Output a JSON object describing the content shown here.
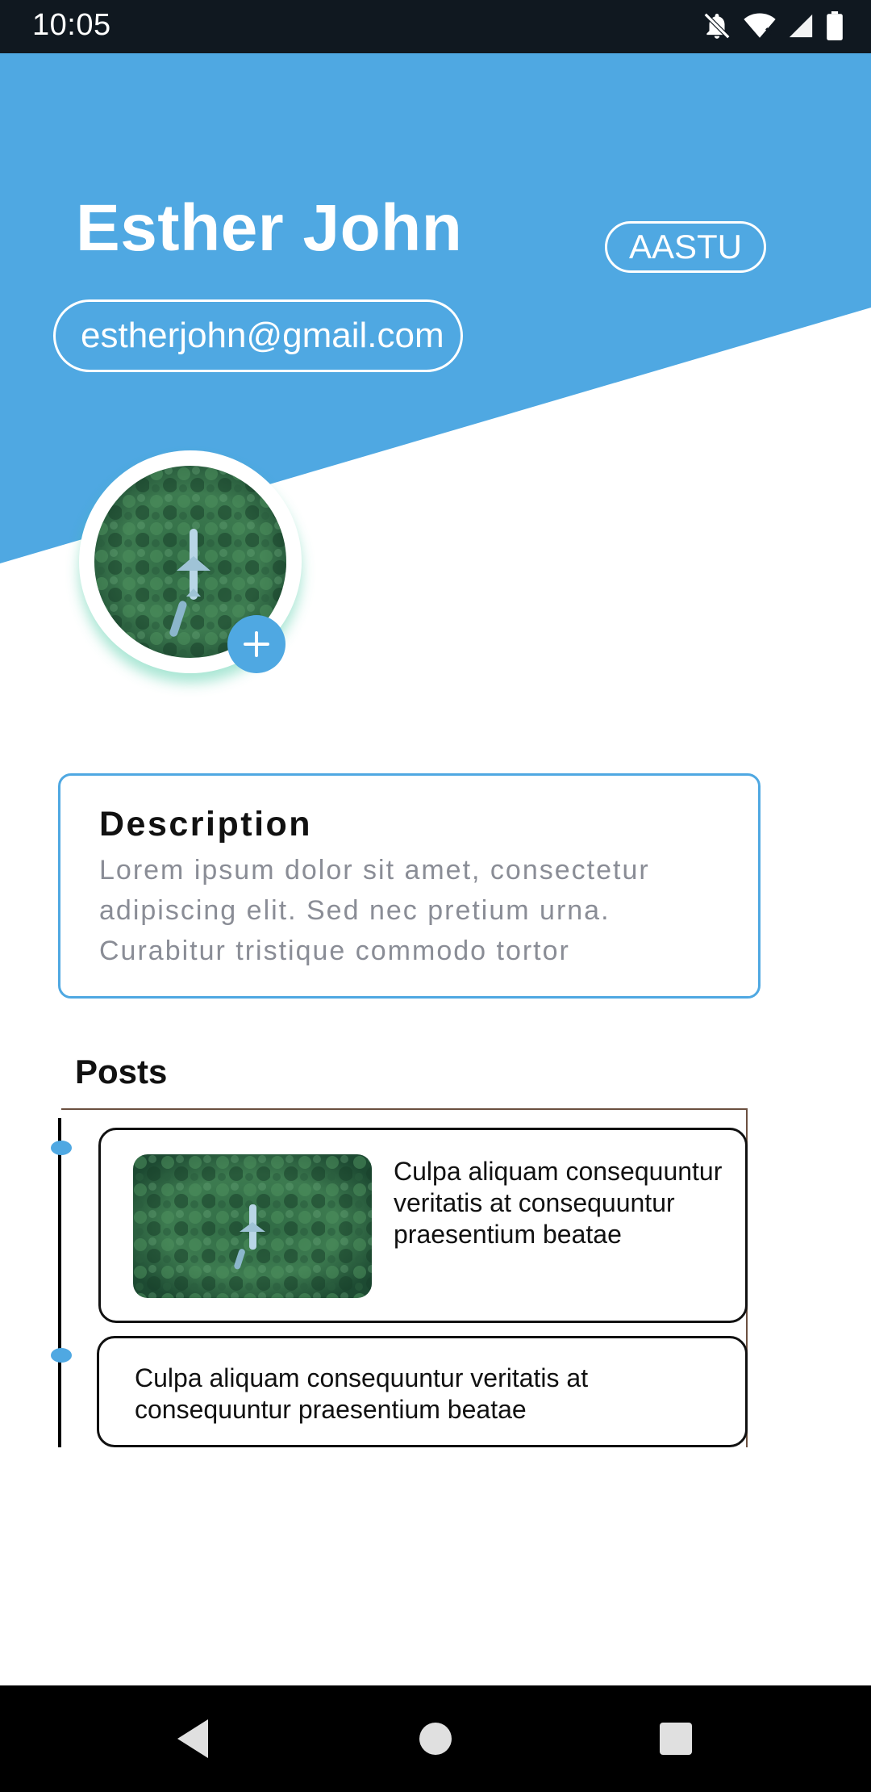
{
  "status_bar": {
    "time": "10:05",
    "icons": [
      "bell-off-icon",
      "wifi-icon",
      "signal-icon",
      "battery-icon"
    ]
  },
  "colors": {
    "accent": "#4fa8e2",
    "status_bar": "#101820",
    "nav_bar": "#000000",
    "forest_dark": "#1f4d34",
    "forest_light": "#4c8f5c"
  },
  "profile": {
    "name": "Esther John",
    "organization": "AASTU",
    "email": "estherjohn@gmail.com",
    "add_photo_icon": "plus-icon"
  },
  "description": {
    "title": "Description",
    "text": "Lorem ipsum dolor sit amet, consectetur adipiscing elit. Sed nec pretium urna. Curabitur tristique commodo tortor"
  },
  "posts": {
    "title": "Posts",
    "items": [
      {
        "text": "Culpa aliquam consequuntur veritatis at consequuntur praesentium beatae",
        "has_image": true
      },
      {
        "text": "Culpa aliquam consequuntur veritatis at consequuntur praesentium beatae",
        "has_image": false
      }
    ]
  },
  "nav_bar": {
    "buttons": [
      "back-icon",
      "home-icon",
      "recents-icon"
    ]
  }
}
